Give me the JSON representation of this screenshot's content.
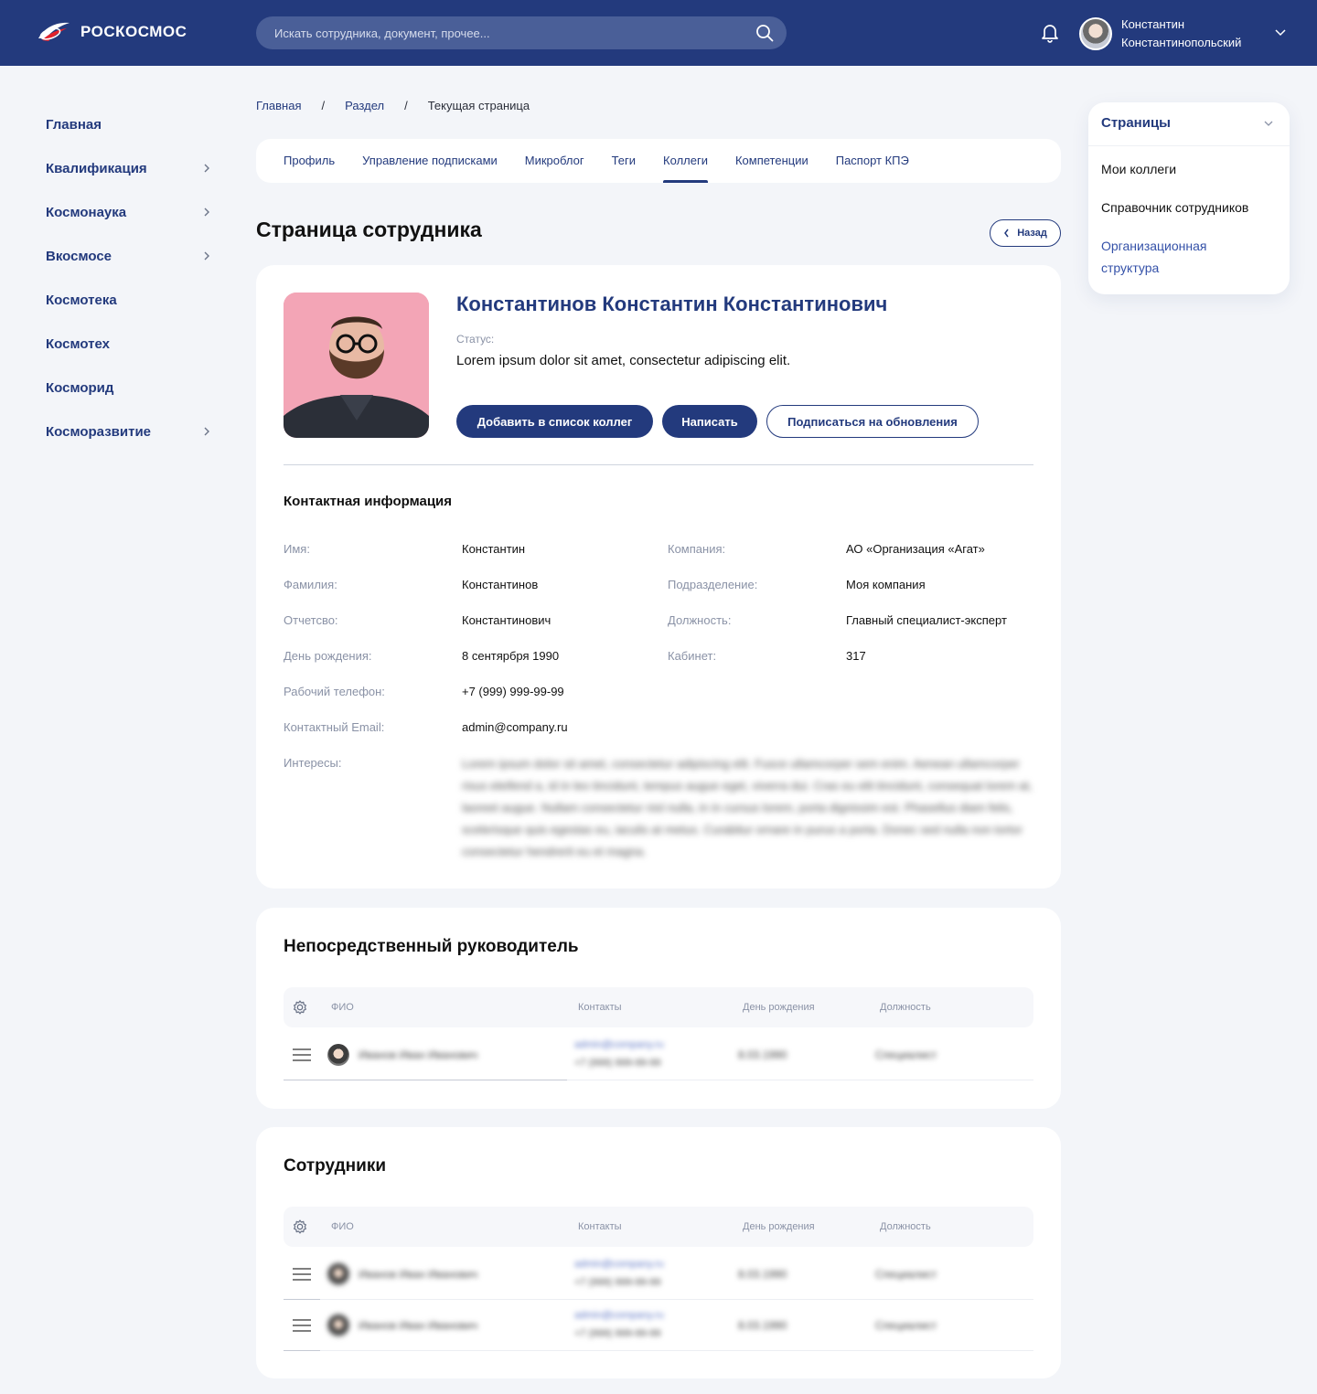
{
  "header": {
    "logo_text": "РОСКОСМОС",
    "search_placeholder": "Искать сотрудника, документ, прочее...",
    "user_first": "Константин",
    "user_last": "Константинопольский"
  },
  "leftnav": {
    "items": [
      {
        "label": "Главная",
        "chevron": false
      },
      {
        "label": "Квалификация",
        "chevron": true
      },
      {
        "label": "Космонаука",
        "chevron": true
      },
      {
        "label": "Вкосмосе",
        "chevron": true
      },
      {
        "label": "Космотека",
        "chevron": false
      },
      {
        "label": "Космотех",
        "chevron": false
      },
      {
        "label": "Косморид",
        "chevron": false
      },
      {
        "label": "Косморазвитие",
        "chevron": true
      }
    ]
  },
  "breadcrumb": {
    "items": [
      "Главная",
      "Раздел",
      "Текущая страница"
    ],
    "separator": "/"
  },
  "tabs": {
    "items": [
      "Профиль",
      "Управление подписками",
      "Микроблог",
      "Теги",
      "Коллеги",
      "Компетенции",
      "Паспорт КПЭ"
    ],
    "active": "Коллеги"
  },
  "page": {
    "title": "Страница сотрудника",
    "back_label": "Назад"
  },
  "profile": {
    "full_name": "Константинов Константин Константинович",
    "status_label": "Статус:",
    "status_text": "Lorem ipsum dolor sit amet, consectetur adipiscing elit.",
    "add_colleague": "Добавить в список коллег",
    "write": "Написать",
    "subscribe": "Подписаться на обновления"
  },
  "contacts": {
    "title": "Контактная информация",
    "left": [
      {
        "label": "Имя:",
        "value": "Константин"
      },
      {
        "label": "Фамилия:",
        "value": "Константинов"
      },
      {
        "label": "Отчетсво:",
        "value": "Константинович"
      },
      {
        "label": "День рождения:",
        "value": "8 сентярбря 1990"
      },
      {
        "label": "Рабочий телефон:",
        "value": "+7 (999) 999-99-99"
      },
      {
        "label": "Контактный Email:",
        "value": "admin@company.ru"
      }
    ],
    "right": [
      {
        "label": "Компания:",
        "value": "АО «Организация «Агат»"
      },
      {
        "label": "Подразделение:",
        "value": "Моя компания"
      },
      {
        "label": "Должность:",
        "value": "Главный специалист-эксперт"
      },
      {
        "label": "Кабинет:",
        "value": "317"
      }
    ],
    "interests_label": "Интересы:",
    "interests_text": "Lorem ipsum dolor sit amet, consectetur adipiscing elit. Fusce ullamcorper sem enim. Aenean ullamcorper risus eleifend a, id in leo tincidunt, tempus augue eget, viverra dui. Cras eu elit tincidunt, consequat lorem at, laoreet augue. Nullam consectetur nisl nulla, in in cursus lorem, porta dignissim est. Phasellus diam felis, scelerisque quis egestas eu, iaculis at metus. Curabitur ornare in purus a porta. Donec sed nulla non tortor consectetur hendrerit eu et magna."
  },
  "table_headers": {
    "name": "ФИО",
    "contacts": "Контакты",
    "birthday": "День рождения",
    "position": "Должность"
  },
  "manager": {
    "title": "Непосредственный руководитель",
    "rows": [
      {
        "name": "Иванов Иван Иванович",
        "email": "admin@company.ru",
        "phone": "+7 (999) 999-99-99",
        "birthday": "8.03.1990",
        "position": "Специалист"
      }
    ]
  },
  "employees": {
    "title": "Сотрудники",
    "rows": [
      {
        "name": "Иванов Иван Иванович",
        "email": "admin@company.ru",
        "phone": "+7 (999) 999-99-99",
        "birthday": "8.03.1990",
        "position": "Специалист"
      },
      {
        "name": "Иванов Иван Иванович",
        "email": "admin@company.ru",
        "phone": "+7 (999) 999-99-99",
        "birthday": "8.03.1990",
        "position": "Специалист"
      }
    ]
  },
  "rpanel": {
    "title": "Страницы",
    "items": [
      "Мои коллеги",
      "Справочник сотрудников",
      "Организационная структура"
    ]
  },
  "colors": {
    "primary": "#233a7d",
    "background": "#f3f5f9",
    "photo_bg": "#f3a5b6"
  }
}
